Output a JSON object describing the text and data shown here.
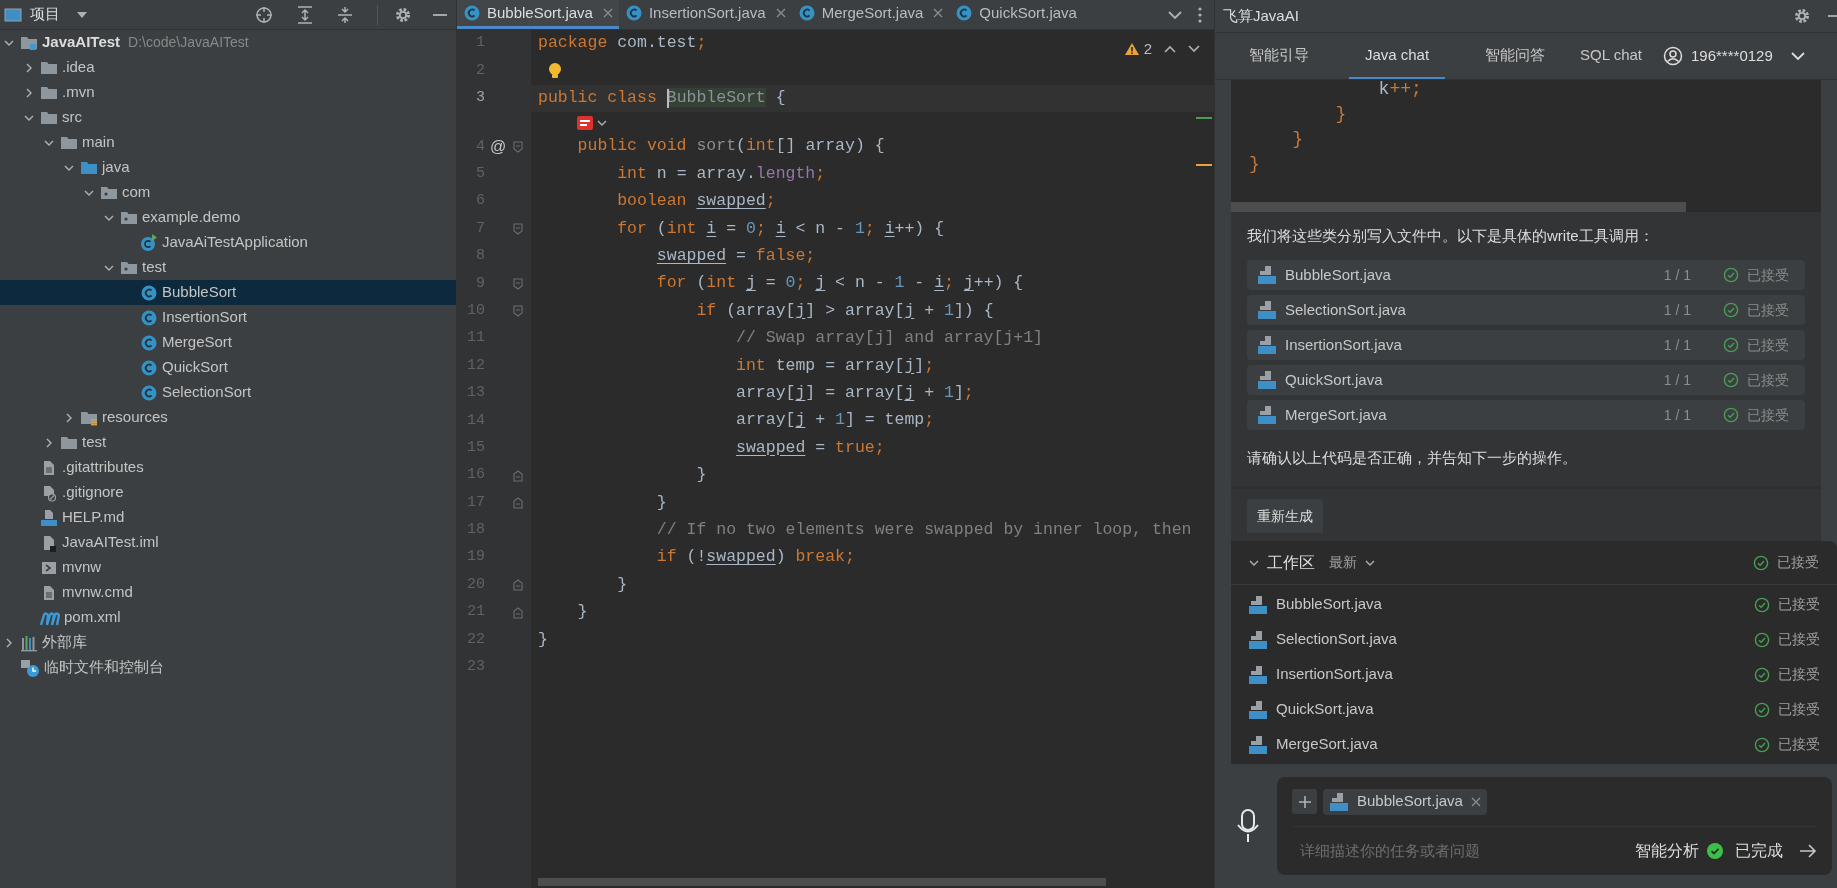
{
  "project_panel": {
    "title": "项目",
    "tree": [
      {
        "label": "JavaAITest",
        "path": "D:\\code\\JavaAITest",
        "kind": "module",
        "expanded": true,
        "selected": false,
        "children": [
          {
            "label": ".idea",
            "kind": "folder",
            "expanded": false,
            "selected": false
          },
          {
            "label": ".mvn",
            "kind": "folder",
            "expanded": false,
            "selected": false
          },
          {
            "label": "src",
            "kind": "folder",
            "expanded": true,
            "selected": false,
            "children": [
              {
                "label": "main",
                "kind": "folder",
                "expanded": true,
                "selected": false,
                "children": [
                  {
                    "label": "java",
                    "kind": "source",
                    "expanded": true,
                    "selected": false,
                    "children": [
                      {
                        "label": "com",
                        "kind": "package",
                        "expanded": true,
                        "selected": false,
                        "children": [
                          {
                            "label": "example.demo",
                            "kind": "package",
                            "expanded": true,
                            "selected": false,
                            "children": [
                              {
                                "label": "JavaAiTestApplication",
                                "kind": "app",
                                "selected": false
                              }
                            ]
                          },
                          {
                            "label": "test",
                            "kind": "package",
                            "expanded": true,
                            "selected": false,
                            "children": [
                              {
                                "label": "BubbleSort",
                                "kind": "class",
                                "selected": true
                              },
                              {
                                "label": "InsertionSort",
                                "kind": "class",
                                "selected": false
                              },
                              {
                                "label": "MergeSort",
                                "kind": "class",
                                "selected": false
                              },
                              {
                                "label": "QuickSort",
                                "kind": "class",
                                "selected": false
                              },
                              {
                                "label": "SelectionSort",
                                "kind": "class",
                                "selected": false
                              }
                            ]
                          }
                        ]
                      }
                    ]
                  },
                  {
                    "label": "resources",
                    "kind": "resources",
                    "expanded": false,
                    "selected": false
                  }
                ]
              },
              {
                "label": "test",
                "kind": "folder",
                "expanded": false,
                "selected": false
              }
            ]
          },
          {
            "label": ".gitattributes",
            "kind": "file",
            "selected": false
          },
          {
            "label": ".gitignore",
            "kind": "ignore",
            "selected": false
          },
          {
            "label": "HELP.md",
            "kind": "md",
            "selected": false
          },
          {
            "label": "JavaAITest.iml",
            "kind": "iml",
            "selected": false
          },
          {
            "label": "mvnw",
            "kind": "shell",
            "selected": false
          },
          {
            "label": "mvnw.cmd",
            "kind": "file",
            "selected": false
          },
          {
            "label": "pom.xml",
            "kind": "maven",
            "selected": false
          }
        ]
      },
      {
        "label": "外部库",
        "kind": "library",
        "expanded": false,
        "selected": false
      },
      {
        "label": "临时文件和控制台",
        "kind": "scratch",
        "selected": false
      }
    ]
  },
  "editor": {
    "tabs": [
      {
        "label": "BubbleSort.java",
        "selected": true,
        "closable": true
      },
      {
        "label": "InsertionSort.java",
        "selected": false,
        "closable": true
      },
      {
        "label": "MergeSort.java",
        "selected": false,
        "closable": true
      },
      {
        "label": "QuickSort.java",
        "selected": false,
        "closable": false
      }
    ],
    "warnings": "2",
    "lines": [
      {
        "number": "1",
        "current": false,
        "tokens": [
          {
            "text": "package",
            "kind": "kw"
          },
          {
            "text": " com.test",
            "kind": "plain"
          },
          {
            "text": ";",
            "kind": "kw"
          }
        ]
      },
      {
        "number": "2",
        "current": false,
        "bulb": true
      },
      {
        "number": "3",
        "current": true,
        "code_vision": true,
        "tokens": [
          {
            "text": "public class ",
            "kind": "kw"
          },
          {
            "text": "BubbleSort",
            "kind": "match"
          },
          {
            "text": " {",
            "kind": "plain"
          }
        ]
      },
      {
        "number": "4",
        "current": false,
        "gutter_mark": "@",
        "fold_start": true,
        "tokens": [
          {
            "text": "    public void ",
            "kind": "kw"
          },
          {
            "text": "sort",
            "kind": "unused"
          },
          {
            "text": "(",
            "kind": "plain"
          },
          {
            "text": "int",
            "kind": "kw"
          },
          {
            "text": "[] array) {",
            "kind": "plain"
          }
        ]
      },
      {
        "number": "5",
        "current": false,
        "tokens": [
          {
            "text": "        int",
            "kind": "kw"
          },
          {
            "text": " n = array.",
            "kind": "plain"
          },
          {
            "text": "length",
            "kind": "field"
          },
          {
            "text": ";",
            "kind": "kw"
          }
        ]
      },
      {
        "number": "6",
        "current": false,
        "tokens": [
          {
            "text": "        boolean ",
            "kind": "kw"
          },
          {
            "text": "swapped",
            "kind": "var"
          },
          {
            "text": ";",
            "kind": "kw"
          }
        ]
      },
      {
        "number": "7",
        "current": false,
        "fold_start": true,
        "tokens": [
          {
            "text": "        for ",
            "kind": "kw"
          },
          {
            "text": "(",
            "kind": "plain"
          },
          {
            "text": "int ",
            "kind": "kw"
          },
          {
            "text": "i",
            "kind": "var"
          },
          {
            "text": " = ",
            "kind": "plain"
          },
          {
            "text": "0",
            "kind": "num"
          },
          {
            "text": "; ",
            "kind": "kw"
          },
          {
            "text": "i",
            "kind": "var"
          },
          {
            "text": " < n - ",
            "kind": "plain"
          },
          {
            "text": "1",
            "kind": "num"
          },
          {
            "text": "; ",
            "kind": "kw"
          },
          {
            "text": "i",
            "kind": "var"
          },
          {
            "text": "++) {",
            "kind": "plain"
          }
        ]
      },
      {
        "number": "8",
        "current": false,
        "tokens": [
          {
            "text": "            swapped",
            "kind": "var"
          },
          {
            "text": " = ",
            "kind": "plain"
          },
          {
            "text": "false;",
            "kind": "kw"
          }
        ]
      },
      {
        "number": "9",
        "current": false,
        "fold_start": true,
        "tokens": [
          {
            "text": "            for ",
            "kind": "kw"
          },
          {
            "text": "(",
            "kind": "plain"
          },
          {
            "text": "int ",
            "kind": "kw"
          },
          {
            "text": "j",
            "kind": "var"
          },
          {
            "text": " = ",
            "kind": "plain"
          },
          {
            "text": "0",
            "kind": "num"
          },
          {
            "text": "; ",
            "kind": "kw"
          },
          {
            "text": "j",
            "kind": "var"
          },
          {
            "text": " < n - ",
            "kind": "plain"
          },
          {
            "text": "1",
            "kind": "num"
          },
          {
            "text": " - ",
            "kind": "plain"
          },
          {
            "text": "i",
            "kind": "var"
          },
          {
            "text": "; ",
            "kind": "kw"
          },
          {
            "text": "j",
            "kind": "var"
          },
          {
            "text": "++) {",
            "kind": "plain"
          }
        ]
      },
      {
        "number": "10",
        "current": false,
        "fold_start": true,
        "tokens": [
          {
            "text": "                if ",
            "kind": "kw"
          },
          {
            "text": "(array[",
            "kind": "plain"
          },
          {
            "text": "j",
            "kind": "var"
          },
          {
            "text": "] > array[",
            "kind": "plain"
          },
          {
            "text": "j",
            "kind": "var"
          },
          {
            "text": " + ",
            "kind": "plain"
          },
          {
            "text": "1",
            "kind": "num"
          },
          {
            "text": "]) {",
            "kind": "plain"
          }
        ]
      },
      {
        "number": "11",
        "current": false,
        "tokens": [
          {
            "text": "                    // Swap array[j] and array[j+1]",
            "kind": "comment"
          }
        ]
      },
      {
        "number": "12",
        "current": false,
        "tokens": [
          {
            "text": "                    int ",
            "kind": "kw"
          },
          {
            "text": "temp = array[",
            "kind": "plain"
          },
          {
            "text": "j",
            "kind": "var"
          },
          {
            "text": "]",
            "kind": "plain"
          },
          {
            "text": ";",
            "kind": "kw"
          }
        ]
      },
      {
        "number": "13",
        "current": false,
        "tokens": [
          {
            "text": "                    array[",
            "kind": "plain"
          },
          {
            "text": "j",
            "kind": "var"
          },
          {
            "text": "] = array[",
            "kind": "plain"
          },
          {
            "text": "j",
            "kind": "var"
          },
          {
            "text": " + ",
            "kind": "plain"
          },
          {
            "text": "1",
            "kind": "num"
          },
          {
            "text": "]",
            "kind": "plain"
          },
          {
            "text": ";",
            "kind": "kw"
          }
        ]
      },
      {
        "number": "14",
        "current": false,
        "tokens": [
          {
            "text": "                    array[",
            "kind": "plain"
          },
          {
            "text": "j",
            "kind": "var"
          },
          {
            "text": " + ",
            "kind": "plain"
          },
          {
            "text": "1",
            "kind": "num"
          },
          {
            "text": "] = temp",
            "kind": "plain"
          },
          {
            "text": ";",
            "kind": "kw"
          }
        ]
      },
      {
        "number": "15",
        "current": false,
        "tokens": [
          {
            "text": "                    swapped",
            "kind": "var"
          },
          {
            "text": " = ",
            "kind": "plain"
          },
          {
            "text": "true;",
            "kind": "kw"
          }
        ]
      },
      {
        "number": "16",
        "current": false,
        "fold_end": true,
        "tokens": [
          {
            "text": "                }",
            "kind": "plain"
          }
        ]
      },
      {
        "number": "17",
        "current": false,
        "fold_end": true,
        "tokens": [
          {
            "text": "            }",
            "kind": "plain"
          }
        ]
      },
      {
        "number": "18",
        "current": false,
        "tokens": [
          {
            "text": "            // If no two elements were swapped by inner loop, then",
            "kind": "comment"
          }
        ]
      },
      {
        "number": "19",
        "current": false,
        "tokens": [
          {
            "text": "            if ",
            "kind": "kw"
          },
          {
            "text": "(!",
            "kind": "plain"
          },
          {
            "text": "swapped",
            "kind": "var"
          },
          {
            "text": ") ",
            "kind": "plain"
          },
          {
            "text": "break;",
            "kind": "kw"
          }
        ]
      },
      {
        "number": "20",
        "current": false,
        "fold_end": true,
        "tokens": [
          {
            "text": "        }",
            "kind": "plain"
          }
        ]
      },
      {
        "number": "21",
        "current": false,
        "fold_end": true,
        "tokens": [
          {
            "text": "    }",
            "kind": "plain"
          }
        ]
      },
      {
        "number": "22",
        "current": false,
        "tokens": [
          {
            "text": "}",
            "kind": "plain"
          }
        ]
      },
      {
        "number": "23",
        "current": false
      }
    ]
  },
  "ai_panel": {
    "title": "飞算JavaAI",
    "tabs": [
      {
        "label": "智能引导",
        "selected": false
      },
      {
        "label": "Java chat",
        "selected": true
      },
      {
        "label": "智能问答",
        "selected": false
      },
      {
        "label": "SQL chat",
        "selected": false
      }
    ],
    "user": "196****0129",
    "code_snippet": [
      [
        {
          "text": "            k",
          "kind": "plain"
        },
        {
          "text": "++;",
          "kind": "kw"
        }
      ],
      [
        {
          "text": "        }",
          "kind": "kw"
        }
      ],
      [
        {
          "text": "    }",
          "kind": "kw"
        }
      ],
      [
        {
          "text": "}",
          "kind": "kw"
        }
      ]
    ],
    "message": "我们将这些类分别写入文件中。以下是具体的write工具调用：",
    "files": [
      {
        "name": "BubbleSort.java",
        "count": "1 / 1",
        "status": "已接受"
      },
      {
        "name": "SelectionSort.java",
        "count": "1 / 1",
        "status": "已接受"
      },
      {
        "name": "InsertionSort.java",
        "count": "1 / 1",
        "status": "已接受"
      },
      {
        "name": "QuickSort.java",
        "count": "1 / 1",
        "status": "已接受"
      },
      {
        "name": "MergeSort.java",
        "count": "1 / 1",
        "status": "已接受"
      }
    ],
    "followup": "请确认以上代码是否正确，并告知下一步的操作。",
    "regenerate": "重新生成",
    "workspace": {
      "title": "工作区",
      "filter": "最新",
      "status": "已接受",
      "files": [
        {
          "name": "BubbleSort.java",
          "status": "已接受"
        },
        {
          "name": "SelectionSort.java",
          "status": "已接受"
        },
        {
          "name": "InsertionSort.java",
          "status": "已接受"
        },
        {
          "name": "QuickSort.java",
          "status": "已接受"
        },
        {
          "name": "MergeSort.java",
          "status": "已接受"
        }
      ]
    },
    "input": {
      "attachment": "BubbleSort.java",
      "placeholder": "详细描述你的任务或者问题",
      "mode": "智能分析",
      "state": "已完成"
    }
  }
}
